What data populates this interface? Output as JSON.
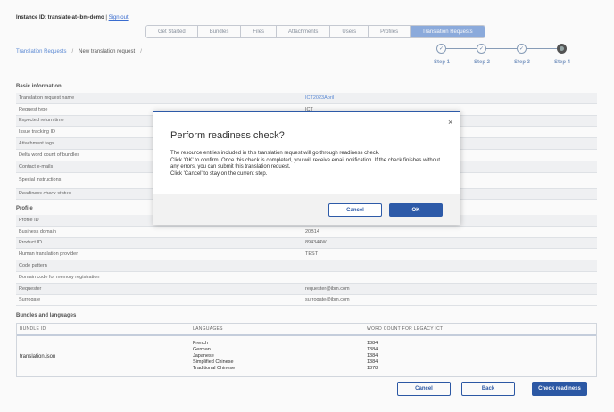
{
  "header": {
    "instance": "Instance ID: translate-at-ibm-demo",
    "separator": " | ",
    "sign_out": "Sign out"
  },
  "tabs": [
    {
      "label": "Get Started",
      "active": false
    },
    {
      "label": "Bundles",
      "active": false
    },
    {
      "label": "Files",
      "active": false
    },
    {
      "label": "Attachments",
      "active": false
    },
    {
      "label": "Users",
      "active": false
    },
    {
      "label": "Profiles",
      "active": false
    },
    {
      "label": "Translation Requests",
      "active": true
    }
  ],
  "breadcrumb": {
    "parent": "Translation Requests",
    "sep": "/",
    "current": "New translation request",
    "trail": "/"
  },
  "steps": [
    {
      "label": "Step 1",
      "state": "done"
    },
    {
      "label": "Step 2",
      "state": "done"
    },
    {
      "label": "Step 3",
      "state": "done"
    },
    {
      "label": "Step 4",
      "state": "current"
    }
  ],
  "basic_info": {
    "title": "Basic information",
    "rows": [
      {
        "key": "Translation request name",
        "value": "ICT2023April",
        "link": true
      },
      {
        "key": "Request type",
        "value": "ICT"
      },
      {
        "key": "Expected return time",
        "value": ""
      },
      {
        "key": "Issue tracking ID",
        "value": ""
      },
      {
        "key": "Attachment tags",
        "value": ""
      },
      {
        "key": "Delta word count of bundles",
        "value": ""
      },
      {
        "key": "Contact e-mails",
        "value": ""
      },
      {
        "key": "Special instructions",
        "value": ""
      },
      {
        "key": "Readiness check status",
        "value": ""
      }
    ]
  },
  "profile": {
    "title": "Profile",
    "rows": [
      {
        "key": "Profile ID",
        "value": ""
      },
      {
        "key": "Business domain",
        "value": "20B14"
      },
      {
        "key": "Product ID",
        "value": "894344W"
      },
      {
        "key": "Human translation provider",
        "value": "TEST"
      },
      {
        "key": "Code pattern",
        "value": ""
      },
      {
        "key": "Domain code for memory registration",
        "value": ""
      },
      {
        "key": "Requester",
        "value": "requester@ibm.com"
      },
      {
        "key": "Surrogate",
        "value": "surrogate@ibm.com"
      }
    ]
  },
  "bundles": {
    "title": "Bundles and languages",
    "columns": [
      "BUNDLE ID",
      "LANGUAGES",
      "WORD COUNT FOR LEGACY ICT"
    ],
    "row": {
      "bundle_id": "translation.json",
      "languages": [
        "French",
        "German",
        "Japanese",
        "Simplified Chinese",
        "Traditional Chinese"
      ],
      "counts": [
        "1384",
        "1384",
        "1384",
        "1384",
        "1378"
      ]
    }
  },
  "footer": {
    "cancel": "Cancel",
    "back": "Back",
    "check": "Check readiness"
  },
  "modal": {
    "title": "Perform readiness check?",
    "close": "×",
    "line1": "The resource entries included in this translation request will go through readiness check.",
    "line2": "Click 'OK' to confirm. Once this check is completed, you will receive email notification. If the check finishes without any errors, you can submit this translation request.",
    "line3": "Click 'Cancel' to stay on the current step.",
    "cancel": "Cancel",
    "ok": "OK"
  },
  "colors": {
    "primary": "#2d5aa8",
    "tab_active": "#8eaee0",
    "link": "#5b8bd8"
  }
}
